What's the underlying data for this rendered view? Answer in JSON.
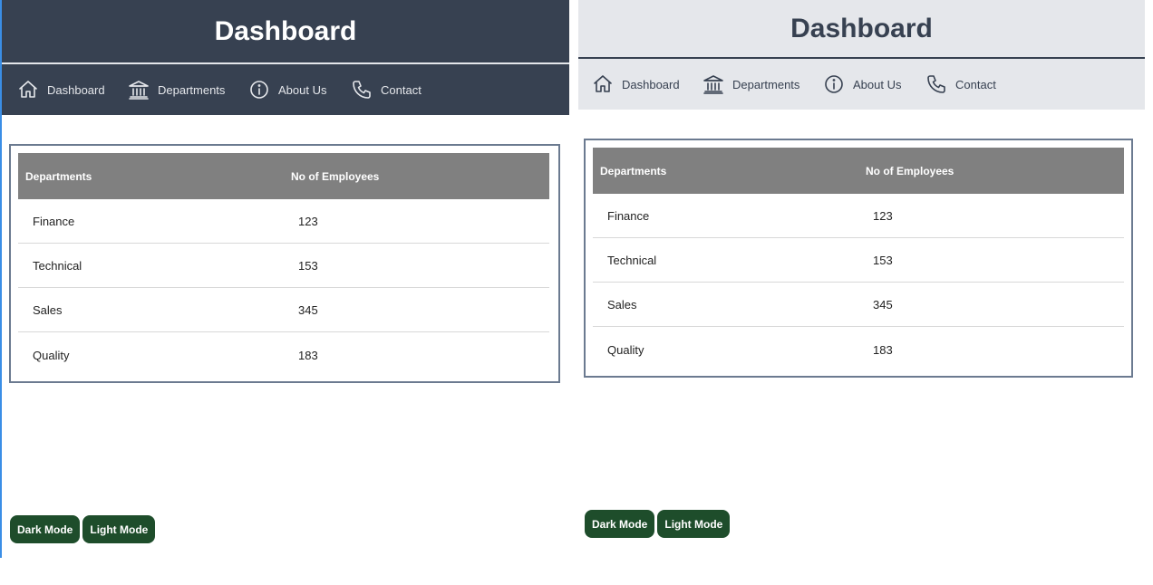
{
  "panels": [
    {
      "mode": "dark",
      "title": "Dashboard",
      "nav": [
        {
          "label": "Dashboard",
          "icon": "home-icon"
        },
        {
          "label": "Departments",
          "icon": "bank-icon"
        },
        {
          "label": "About Us",
          "icon": "info-icon"
        },
        {
          "label": "Contact",
          "icon": "phone-icon"
        }
      ],
      "table": {
        "headers": [
          "Departments",
          "No of Employees"
        ],
        "rows": [
          [
            "Finance",
            "123"
          ],
          [
            "Technical",
            "153"
          ],
          [
            "Sales",
            "345"
          ],
          [
            "Quality",
            "183"
          ]
        ]
      },
      "buttons": {
        "dark": "Dark Mode",
        "light": "Light Mode"
      }
    },
    {
      "mode": "light",
      "title": "Dashboard",
      "nav": [
        {
          "label": "Dashboard",
          "icon": "home-icon"
        },
        {
          "label": "Departments",
          "icon": "bank-icon"
        },
        {
          "label": "About Us",
          "icon": "info-icon"
        },
        {
          "label": "Contact",
          "icon": "phone-icon"
        }
      ],
      "table": {
        "headers": [
          "Departments",
          "No of Employees"
        ],
        "rows": [
          [
            "Finance",
            "123"
          ],
          [
            "Technical",
            "153"
          ],
          [
            "Sales",
            "345"
          ],
          [
            "Quality",
            "183"
          ]
        ]
      },
      "buttons": {
        "dark": "Dark Mode",
        "light": "Light Mode"
      }
    }
  ],
  "colors": {
    "dark_header": "#374151",
    "light_header": "#e5e7eb",
    "table_header": "#808080",
    "button": "#1e4d2b"
  }
}
